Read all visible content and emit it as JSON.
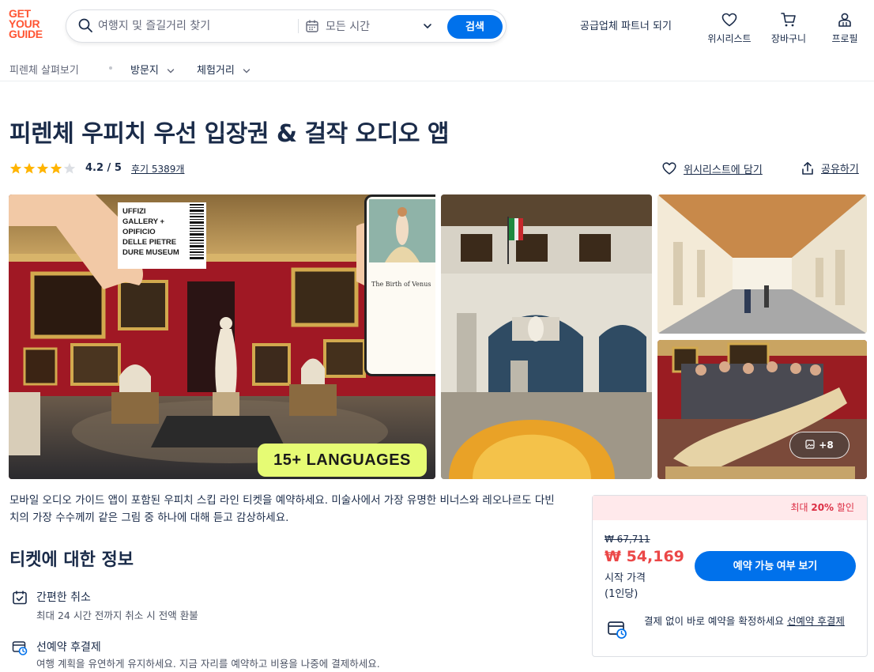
{
  "header": {
    "logo_lines": [
      "GET",
      "YOUR",
      "GUIDE"
    ],
    "search_placeholder": "여행지 및 즐길거리 찾기",
    "date_label": "모든 시간",
    "search_button": "검색",
    "partner_link": "공급업체 파트너 되기",
    "nav": {
      "wishlist": "위시리스트",
      "cart": "장바구니",
      "profile": "프로필"
    }
  },
  "subnav": {
    "explore": "피렌체 살펴보기",
    "places": "방문지",
    "activities": "체험거리"
  },
  "product": {
    "title": "피렌체 우피치 우선 입장권 & 걸작 오디오 앱",
    "rating": "4.2 / 5",
    "rating_value": 4.2,
    "rating_max": 5,
    "reviews": "후기 5389개",
    "wishlist_link": "위시리스트에 담기",
    "share_link": "공유하기"
  },
  "gallery": {
    "ticket_text": [
      "UFFIZI",
      "GALLERY +",
      "OPIFICIO",
      "DELLE PIETRE",
      "DURE MUSEUM"
    ],
    "phone_title": "The Birth of Venus",
    "languages_badge": "15+ LANGUAGES",
    "more_photos": "+8"
  },
  "description": "모바일 오디오 가이드 앱이 포함된 우피치 스킵 라인 티켓을 예약하세요. 미술사에서 가장 유명한 비너스와 레오나르도 다빈치의 가장 수수께끼 같은 그림 중 하나에 대해 듣고 감상하세요.",
  "ticket_info": {
    "heading": "티켓에 대한 정보",
    "features": [
      {
        "title": "간편한 취소",
        "subtitle": "최대 24 시간 전까지 취소 시 전액 환불"
      },
      {
        "title": "선예약 후결제",
        "subtitle": "여행 계획을 유연하게 유지하세요. 지금 자리를 예약하고 비용을 나중에 결제하세요."
      }
    ]
  },
  "booking": {
    "discount_prefix": "최대 ",
    "discount_value": "20%",
    "discount_suffix": " 할인",
    "old_price": "₩ 67,711",
    "new_price": "₩ 54,169",
    "from_label": "시작 가격",
    "per_label": "(1인당)",
    "check_button": "예약 가능 여부 보기",
    "reserve_text": "결제 없이 바로 예약을 확정하세요 ",
    "reserve_link": "선예약 후결제"
  },
  "colors": {
    "brand_orange": "#ff5533",
    "primary_blue": "#0071eb",
    "price_red": "#eb4747",
    "discount_bg": "#ffe9eb",
    "star_yellow": "#ffb400",
    "lang_badge": "#e6fb74"
  },
  "icons": [
    "search-icon",
    "calendar-icon",
    "chevron-down-icon",
    "heart-icon",
    "cart-icon",
    "profile-icon",
    "star-icon",
    "share-icon",
    "image-icon",
    "calendar-check-icon",
    "reserve-later-icon"
  ]
}
